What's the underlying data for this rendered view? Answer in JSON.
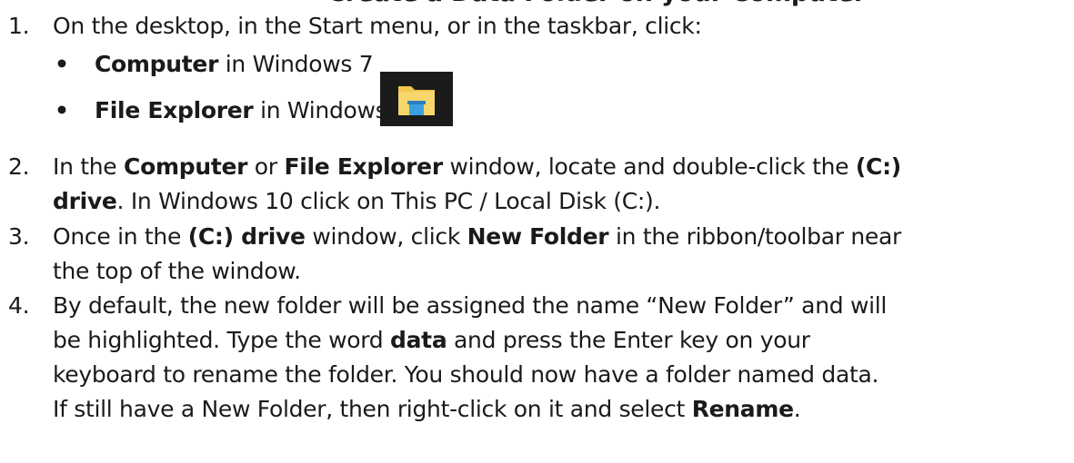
{
  "heading": "Create a Data Folder on your Computer",
  "step1": {
    "num": "1.",
    "text": "On the desktop, in the Start menu, or in the taskbar, click:"
  },
  "bullet1": {
    "bold": "Computer",
    "rest": " in Windows 7"
  },
  "bullet2": {
    "bold": "File Explorer",
    "rest": " in Windows 10",
    "icon": "file-explorer-icon"
  },
  "step2": {
    "num": "2.",
    "l1_a": "In the ",
    "l1_b": "Computer",
    "l1_c": " or ",
    "l1_d": "File Explorer",
    "l1_e": " window, locate and double-click the ",
    "l1_f": "(C:)",
    "l2_a": "drive",
    "l2_b": ". In Windows 10 click on This PC / Local Disk (C:)."
  },
  "step3": {
    "num": "3.",
    "l1_a": "Once in the ",
    "l1_b": "(C:) drive",
    "l1_c": " window, click ",
    "l1_d": "New Folder",
    "l1_e": " in the ribbon/toolbar near",
    "l2": "the top of the window."
  },
  "step4": {
    "num": "4.",
    "l1": "By default, the new folder will be assigned the name “New Folder” and will",
    "l2_a": "be highlighted. Type the word ",
    "l2_b": "data",
    "l2_c": " and press the Enter key on your",
    "l3": "keyboard to rename the folder. You should now have a folder named data.",
    "l4_a": "If still have a New Folder, then right-click on it and select ",
    "l4_b": "Rename",
    "l4_c": "."
  },
  "colors": {
    "text": "#1a1a1a",
    "icon_folder": "#f3c64a",
    "icon_bg": "#1b1b1b",
    "icon_accent": "#3aa0e0"
  }
}
